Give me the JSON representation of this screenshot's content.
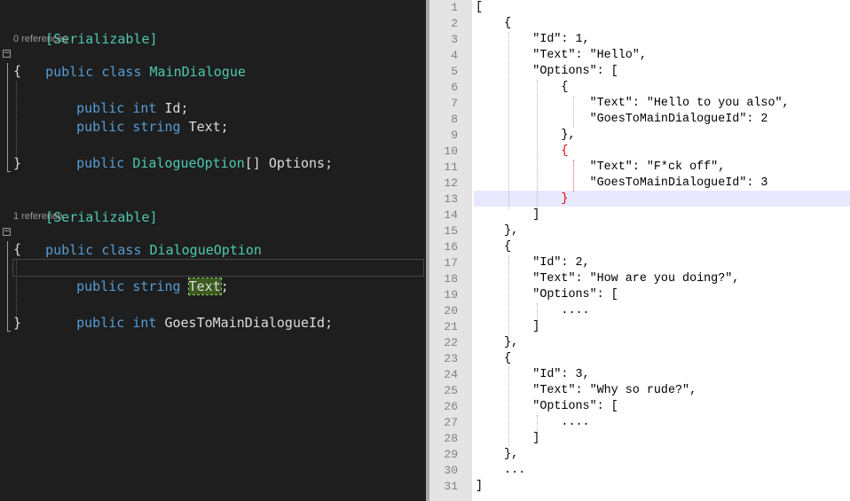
{
  "csharp": {
    "attr1": "[Serializable]",
    "refs1": "0 references",
    "class1_kw": "public class",
    "class1_name": "MainDialogue",
    "brace_open": "{",
    "brace_close": "}",
    "field1_kw": "public int",
    "field1_name": "Id;",
    "field2_kw": "public string",
    "field2_name": "Text;",
    "field3_kw": "public",
    "field3_type": "DialogueOption",
    "field3_name": "[] Options;",
    "attr2": "[Serializable]",
    "refs2": "1 reference",
    "class2_kw": "public class",
    "class2_name": "DialogueOption",
    "field4_kw": "public string",
    "field4_name": "Text",
    "field4_end": ";",
    "field5_kw": "public int",
    "field5_name": "GoesToMainDialogueId;",
    "collapse_glyph": "−"
  },
  "json_lines": [
    "[",
    "    {",
    "        \"Id\": 1,",
    "        \"Text\": \"Hello\",",
    "        \"Options\": [",
    "            {",
    "                \"Text\": \"Hello to you also\",",
    "                \"GoesToMainDialogueId\": 2",
    "            },",
    "            {",
    "                \"Text\": \"F*ck off\",",
    "                \"GoesToMainDialogueId\": 3",
    "            }",
    "        ]",
    "    },",
    "    {",
    "        \"Id\": 2,",
    "        \"Text\": \"How are you doing?\",",
    "        \"Options\": [",
    "            ....",
    "        ]",
    "    },",
    "    {",
    "        \"Id\": 3,",
    "        \"Text\": \"Why so rude?\",",
    "        \"Options\": [",
    "            ....",
    "        ]",
    "    },",
    "    ...",
    "]"
  ],
  "line_numbers": [
    "1",
    "2",
    "3",
    "4",
    "5",
    "6",
    "7",
    "8",
    "9",
    "10",
    "11",
    "12",
    "13",
    "14",
    "15",
    "16",
    "17",
    "18",
    "19",
    "20",
    "21",
    "22",
    "23",
    "24",
    "25",
    "26",
    "27",
    "28",
    "29",
    "30",
    "31"
  ],
  "colors": {
    "keyword": "#569cd6",
    "type": "#4ec9b0",
    "brace_match": "#e00000"
  }
}
